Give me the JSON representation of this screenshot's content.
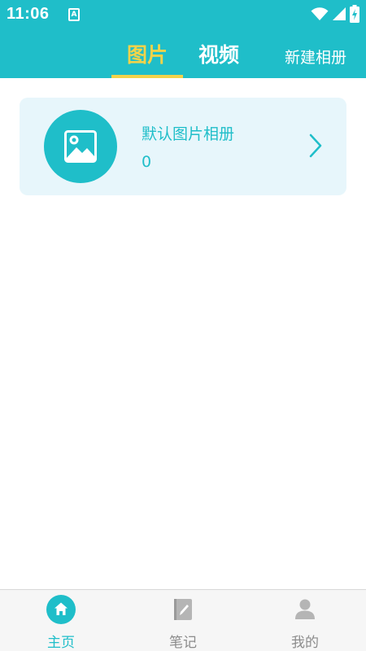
{
  "status_bar": {
    "time": "11:06",
    "indicator_letter": "A"
  },
  "tabs": [
    {
      "label": "图片",
      "active": true
    },
    {
      "label": "视频",
      "active": false
    }
  ],
  "header": {
    "new_album_label": "新建相册"
  },
  "albums": [
    {
      "name": "默认图片相册",
      "count": "0",
      "icon": "image-icon"
    }
  ],
  "bottom_nav": [
    {
      "label": "主页",
      "icon": "home-icon",
      "active": true
    },
    {
      "label": "笔记",
      "icon": "notebook-icon",
      "active": false
    },
    {
      "label": "我的",
      "icon": "user-icon",
      "active": false
    }
  ],
  "colors": {
    "accent": "#1fbec9",
    "active_tab": "#f2d34a",
    "card_background": "#e7f6fb",
    "nav_inactive": "#8c8c8c"
  }
}
